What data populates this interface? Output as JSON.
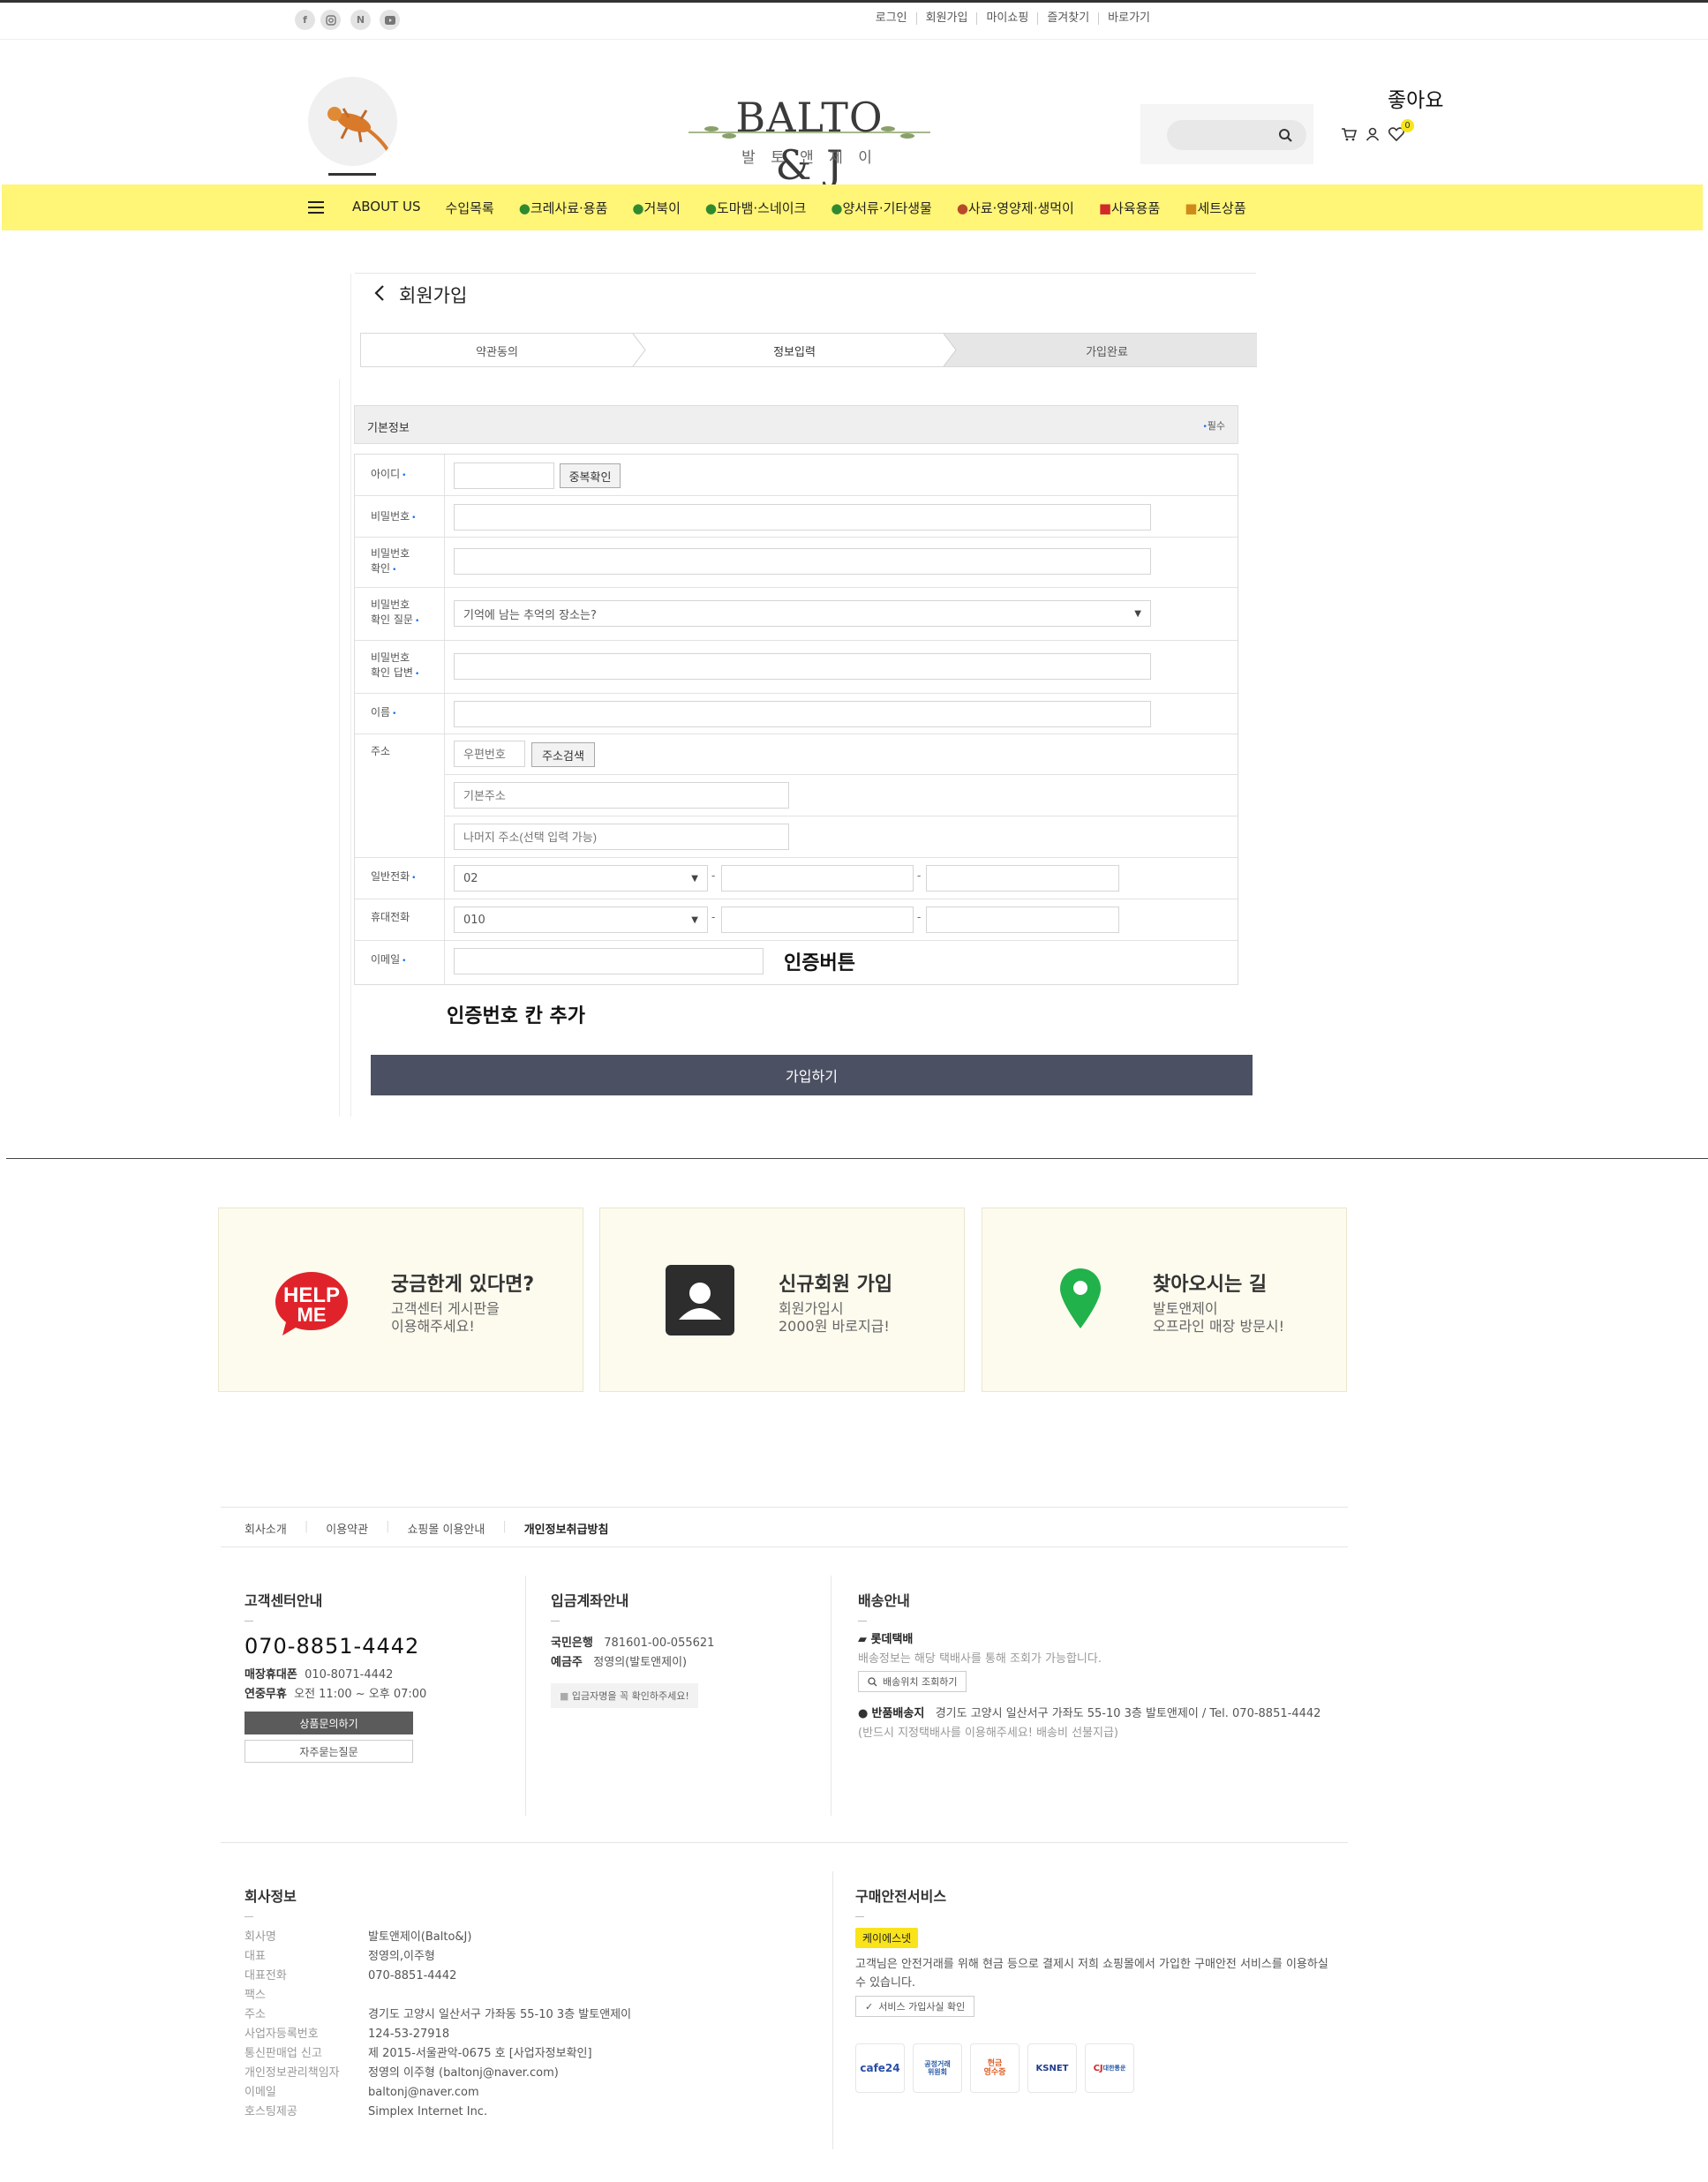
{
  "top_links": [
    "로그인",
    "회원가입",
    "마이쇼핑",
    "즐겨찾기",
    "바로가기"
  ],
  "social_icons": [
    "facebook-icon",
    "instagram-icon",
    "naver-blog-icon",
    "youtube-icon"
  ],
  "logo": {
    "main": "BALTO & J",
    "sub": "발 토 앤 제 이"
  },
  "like_label": "좋아요",
  "wish_count": "0",
  "categories": [
    "ABOUT US",
    "수입목록",
    "크레사료·용품",
    "거북이",
    "도마뱀·스네이크",
    "양서류·기타생물",
    "사료·영양제·생먹이",
    "사육용품",
    "세트상품"
  ],
  "page_title": "회원가입",
  "steps": [
    "약관동의",
    "정보입력",
    "가입완료"
  ],
  "section": {
    "title": "기본정보",
    "required_note": "필수"
  },
  "fields": {
    "id_label": "아이디",
    "dup_check": "중복확인",
    "pw_label": "비밀번호",
    "pw_confirm_label": [
      "비밀번호",
      "확인"
    ],
    "pw_question_label": [
      "비밀번호",
      "확인 질문"
    ],
    "pw_question_value": "기억에 남는 추억의 장소는?",
    "pw_answer_label": [
      "비밀번호",
      "확인 답변"
    ],
    "name_label": "이름",
    "address_label": "주소",
    "zip_placeholder": "우편번호",
    "address_search": "주소검색",
    "addr1_placeholder": "기본주소",
    "addr2_placeholder": "나머지 주소(선택 입력 가능)",
    "phone_label": "일반전화",
    "phone_prefix": "02",
    "mobile_label": "휴대전화",
    "mobile_prefix": "010",
    "email_label": "이메일",
    "dash": "-"
  },
  "annotations": {
    "auth_button": "인증버튼",
    "auth_code": "인증번호 칸 추가"
  },
  "submit_label": "가입하기",
  "cards": [
    {
      "title": "궁금한게 있다면?",
      "lines": [
        "고객센터 게시판을",
        "이용해주세요!"
      ],
      "icon": "help-me-icon"
    },
    {
      "title": "신규회원 가입",
      "lines": [
        "회원가입시",
        "2000원 바로지급!"
      ],
      "icon": "user-profile-icon"
    },
    {
      "title": "찾아오시는 길",
      "lines": [
        "발토앤제이",
        "오프라인 매장 방문시!"
      ],
      "icon": "map-pin-icon"
    }
  ],
  "footer_nav": [
    "회사소개",
    "이용약관",
    "쇼핑몰 이용안내",
    "개인정보취급방침"
  ],
  "cs": {
    "title": "고객센터안내",
    "phone": "070-8851-4442",
    "lines": [
      [
        "매장휴대폰",
        "010-8071-4442"
      ],
      [
        "연중무휴",
        "오전 11:00 ~ 오후 07:00"
      ]
    ],
    "btn1": "상품문의하기",
    "btn2": "자주묻는질문"
  },
  "bank": {
    "title": "입금계좌안내",
    "lines": [
      [
        "국민은행",
        "781601-00-055621"
      ],
      [
        "예금주",
        "정영의(발토앤제이)"
      ]
    ],
    "note": "입금자명을 꼭 확인하주세요!"
  },
  "shipping": {
    "title": "배송안내",
    "carrier": "롯데택배",
    "carrier_note": "배송정보는 해당 택배사를 통해 조회가 가능합니다.",
    "track_btn": "배송위치 조회하기",
    "return_label": "반품배송지",
    "return_addr": "경기도 고양시 일산서구 가좌도 55-10 3층 발토앤제이 / Tel. 070-8851-4442",
    "return_note": "(반드시 지정택배사를 이용해주세요! 배송비 선불지급)"
  },
  "company": {
    "title": "회사정보",
    "rows": [
      [
        "회사명",
        "발토앤제이(Balto&J)"
      ],
      [
        "대표",
        "정영의,이주형"
      ],
      [
        "대표전화",
        "070-8851-4442"
      ],
      [
        "팩스",
        ""
      ],
      [
        "주소",
        "경기도 고양시 일산서구 가좌동 55-10 3층 발토앤제이"
      ],
      [
        "사업자등록번호",
        "124-53-27918"
      ],
      [
        "통신판매업 신고",
        "제 2015-서울관악-0675 호 [사업자정보확인]"
      ],
      [
        "개인정보관리책임자",
        "정영의 이주형 (baltonj@naver.com)"
      ],
      [
        "이메일",
        "baltonj@naver.com"
      ],
      [
        "호스팅제공",
        "Simplex Internet Inc."
      ]
    ]
  },
  "safety": {
    "title": "구매안전서비스",
    "badge": "케이에스넷",
    "text1": "고객님은 안전거래를 위해 현금 등으로 결제시 저희 쇼핑몰에서 가입한 구매안전 서비스를 이용하실",
    "text2": "수 있습니다.",
    "btn": "서비스 가입사실 확인",
    "logos": [
      "cafe24",
      "공정거래위원회",
      "현금영수증",
      "KSNET",
      "CJ대한통운"
    ]
  }
}
